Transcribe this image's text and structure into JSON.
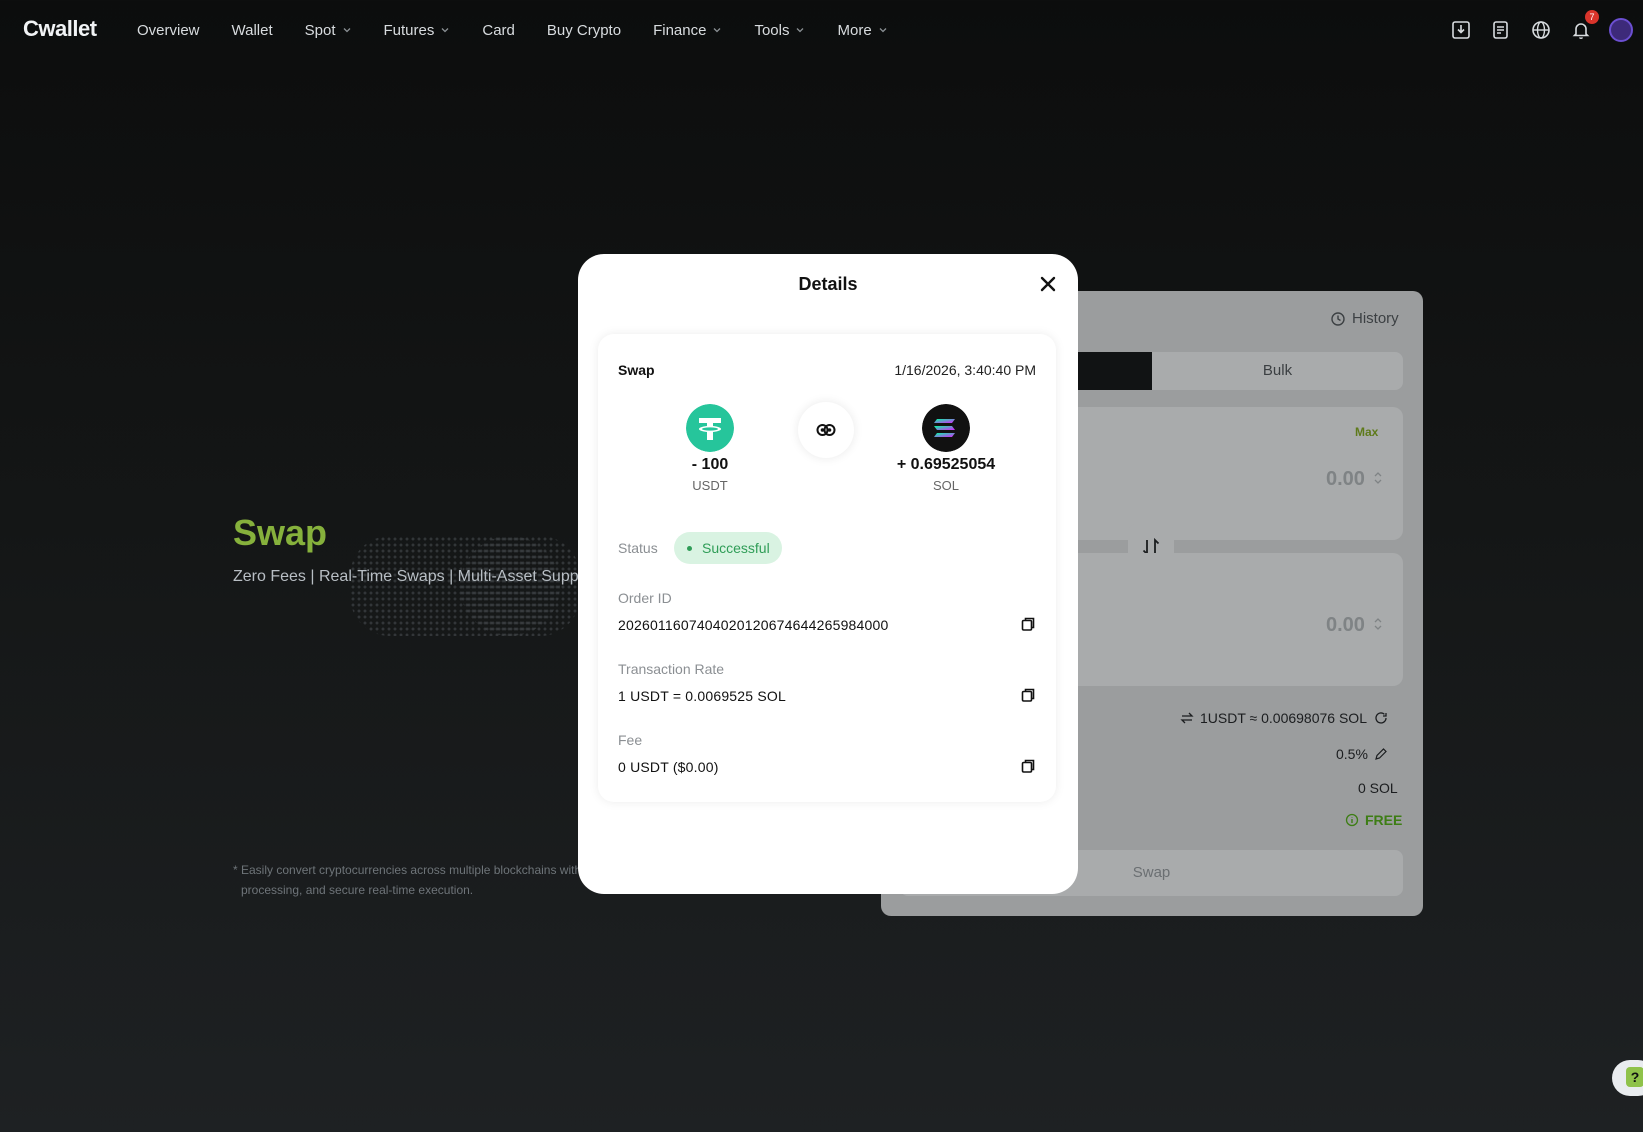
{
  "brand": {
    "logo": "Cwallet"
  },
  "nav": {
    "items": [
      {
        "label": "Overview",
        "dropdown": false
      },
      {
        "label": "Wallet",
        "dropdown": false
      },
      {
        "label": "Spot",
        "dropdown": true
      },
      {
        "label": "Futures",
        "dropdown": true
      },
      {
        "label": "Card",
        "dropdown": false
      },
      {
        "label": "Buy Crypto",
        "dropdown": false
      },
      {
        "label": "Finance",
        "dropdown": true
      },
      {
        "label": "Tools",
        "dropdown": true
      },
      {
        "label": "More",
        "dropdown": true
      }
    ],
    "notification_count": "7"
  },
  "hero": {
    "title": "Swap",
    "subtitle": "Zero Fees | Real-Time Swaps | Multi-Asset Support",
    "footnote_line1": "* Easily convert cryptocurrencies across multiple blockchains with",
    "footnote_line2": "processing, and secure real-time execution."
  },
  "swap_panel": {
    "history_label": "History",
    "tab_bulk": "Bulk",
    "max_label": "Max",
    "from_amount": "0.00",
    "to_amount": "0.00",
    "rate": "1USDT ≈ 0.00698076 SOL",
    "slippage": "0.5%",
    "receive": "0 SOL",
    "fee": "FREE",
    "swap_button": "Swap"
  },
  "modal": {
    "title": "Details",
    "type": "Swap",
    "datetime": "1/16/2026, 3:40:40 PM",
    "from": {
      "amount": "- 100",
      "symbol": "USDT"
    },
    "to": {
      "amount": "+ 0.69525054",
      "symbol": "SOL"
    },
    "status_label": "Status",
    "status_value": "Successful",
    "order_id_label": "Order ID",
    "order_id": "2026011607404020120674644265984000",
    "rate_label": "Transaction Rate",
    "rate_value": "1 USDT = 0.0069525 SOL",
    "fee_label": "Fee",
    "fee_value": "0 USDT ($0.00)"
  },
  "colors": {
    "accent_green": "#86b13c",
    "status_green": "#2f9d57",
    "usdt": "#26c59b",
    "sol_bg": "#111111"
  }
}
